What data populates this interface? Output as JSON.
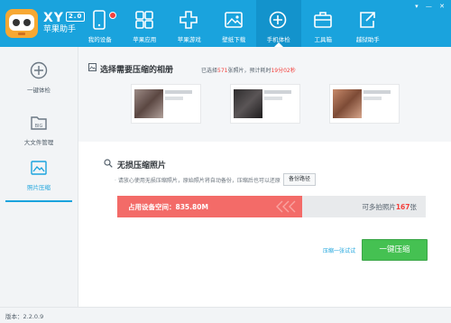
{
  "brand": {
    "name": "XY",
    "version_badge": "2.0",
    "subtitle": "苹果助手"
  },
  "nav": {
    "items": [
      {
        "label": "我的设备",
        "icon": "device-icon",
        "badge": true
      },
      {
        "label": "苹果应用",
        "icon": "apps-grid-icon"
      },
      {
        "label": "苹果游戏",
        "icon": "gamepad-icon"
      },
      {
        "label": "壁纸下载",
        "icon": "image-icon"
      },
      {
        "label": "手机体检",
        "icon": "plus-circle-icon",
        "active": true
      },
      {
        "label": "工具箱",
        "icon": "toolbox-icon"
      },
      {
        "label": "越狱助手",
        "icon": "export-icon"
      }
    ]
  },
  "sidebar": {
    "items": [
      {
        "label": "一键体检",
        "icon": "plus-circle-icon"
      },
      {
        "label": "大文件管理",
        "icon": "big-file-icon"
      },
      {
        "label": "照片压缩",
        "icon": "photo-icon",
        "active": true
      }
    ]
  },
  "albums": {
    "title": "选择需要压缩的相册",
    "info_prefix": "已选择",
    "selected_count": "571",
    "info_middle": "张照片，预计耗时",
    "time_estimate": "19分02秒"
  },
  "compress": {
    "title": "无损压缩照片",
    "description": "请放心使用无损压缩照片，原始照片将自动备份，压缩后也可以还原",
    "backup_button": "备份路径",
    "space_label": "占用设备空间：",
    "space_value": "835.80M",
    "saved_prefix": "可多拍照片",
    "saved_count": "167",
    "saved_suffix": "张",
    "progress_fraction": 0.6,
    "link_text": "压缩一张试试",
    "primary_button": "一键压缩"
  },
  "status": {
    "version": "版本：2.2.0.9"
  },
  "colors": {
    "header": "#1aa3dd",
    "accent_red": "#f3403c",
    "bar_red": "#f36b68",
    "button_green": "#45c152"
  }
}
